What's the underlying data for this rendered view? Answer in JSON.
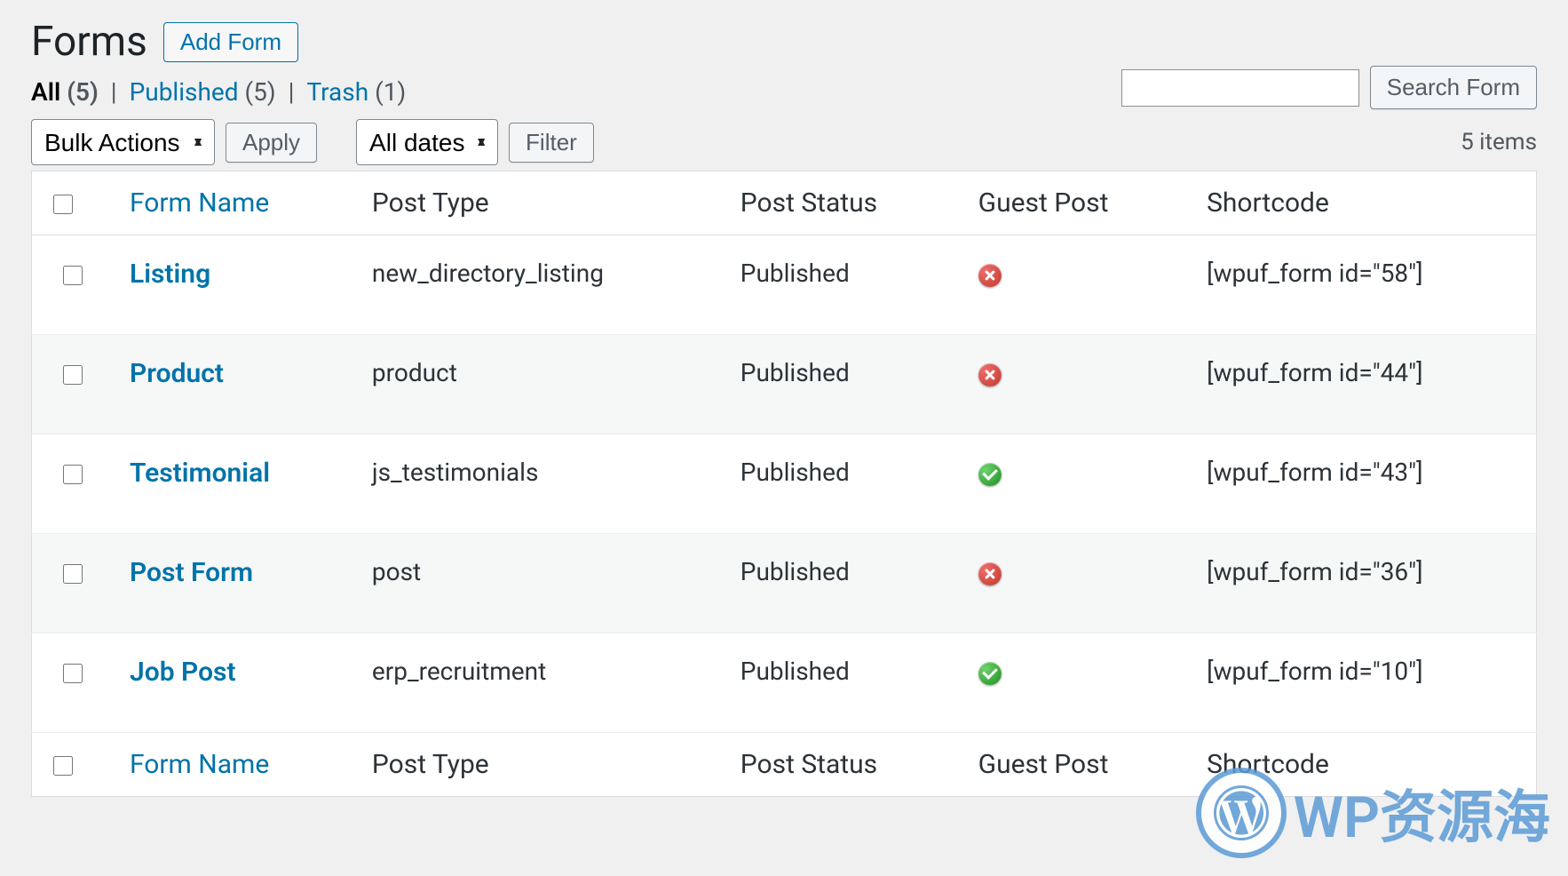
{
  "page": {
    "title": "Forms",
    "add_button": "Add Form"
  },
  "status_filter": {
    "all": {
      "label": "All",
      "count": "(5)"
    },
    "published": {
      "label": "Published",
      "count": "(5)"
    },
    "trash": {
      "label": "Trash",
      "count": "(1)"
    }
  },
  "search": {
    "button": "Search Form",
    "value": ""
  },
  "bulk": {
    "select": "Bulk Actions",
    "apply": "Apply"
  },
  "date_filter": {
    "select": "All dates",
    "filter": "Filter"
  },
  "pagination": {
    "items_text": "5 items"
  },
  "columns": {
    "form_name": "Form Name",
    "post_type": "Post Type",
    "post_status": "Post Status",
    "guest_post": "Guest Post",
    "shortcode": "Shortcode"
  },
  "rows": [
    {
      "name": "Listing",
      "post_type": "new_directory_listing",
      "post_status": "Published",
      "guest_post": "no",
      "shortcode": "[wpuf_form id=\"58\"]"
    },
    {
      "name": "Product",
      "post_type": "product",
      "post_status": "Published",
      "guest_post": "no",
      "shortcode": "[wpuf_form id=\"44\"]"
    },
    {
      "name": "Testimonial",
      "post_type": "js_testimonials",
      "post_status": "Published",
      "guest_post": "yes",
      "shortcode": "[wpuf_form id=\"43\"]"
    },
    {
      "name": "Post Form",
      "post_type": "post",
      "post_status": "Published",
      "guest_post": "no",
      "shortcode": "[wpuf_form id=\"36\"]"
    },
    {
      "name": "Job Post",
      "post_type": "erp_recruitment",
      "post_status": "Published",
      "guest_post": "yes",
      "shortcode": "[wpuf_form id=\"10\"]"
    }
  ],
  "watermark": {
    "text": "WP资源海"
  }
}
